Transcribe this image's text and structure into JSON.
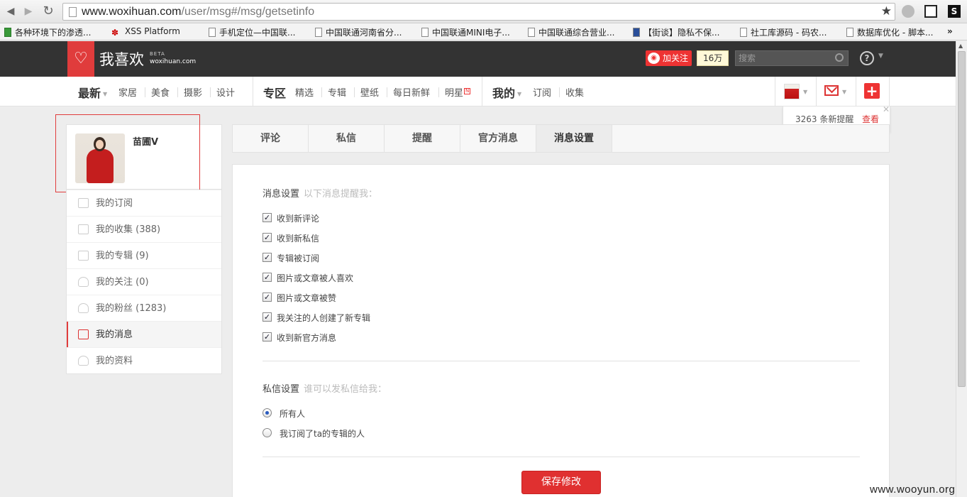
{
  "browser": {
    "url_host": "www.woxihuan.com",
    "url_path": "/user/msg#/msg/getsetinfo",
    "bookmarks": [
      "各种环境下的渗透...",
      "XSS Platform",
      "手机定位—中国联...",
      "中国联通河南省分...",
      "中国联通MINI电子...",
      "中国联通综合营业...",
      "【街谈】隐私不保...",
      "社工库源码 - 码农...",
      "数据库优化 - 脚本..."
    ]
  },
  "header": {
    "logo_text": "我喜欢",
    "logo_beta": "BETA",
    "logo_domain": "woxihuan.com",
    "follow_label": "加关注",
    "fans_count": "16万",
    "search_placeholder": "搜索"
  },
  "nav": {
    "latest": "最新",
    "latest_items": [
      "家居",
      "美食",
      "摄影",
      "设计"
    ],
    "zone": "专区",
    "zone_items": [
      "精选",
      "专辑",
      "壁纸",
      "每日新鲜",
      "明星"
    ],
    "mine": "我的",
    "mine_items": [
      "订阅",
      "收集"
    ]
  },
  "notification": {
    "text": "3263 条新提醒",
    "link": "查看"
  },
  "profile": {
    "username": "苗圃V"
  },
  "side_menu": [
    {
      "label": "我的订阅",
      "active": false
    },
    {
      "label": "我的收集 (388)",
      "active": false
    },
    {
      "label": "我的专辑 (9)",
      "active": false
    },
    {
      "label": "我的关注 (0)",
      "active": false
    },
    {
      "label": "我的粉丝 (1283)",
      "active": false
    },
    {
      "label": "我的消息",
      "active": true
    },
    {
      "label": "我的资料",
      "active": false
    }
  ],
  "tabs": [
    "评论",
    "私信",
    "提醒",
    "官方消息",
    "消息设置"
  ],
  "message_settings": {
    "title": "消息设置",
    "hint": "以下消息提醒我：",
    "options": [
      "收到新评论",
      "收到新私信",
      "专辑被订阅",
      "图片或文章被人喜欢",
      "图片或文章被赞",
      "我关注的人创建了新专辑",
      "收到新官方消息"
    ]
  },
  "private_settings": {
    "title": "私信设置",
    "hint": "谁可以发私信给我：",
    "options": [
      "所有人",
      "我订阅了ta的专辑的人"
    ],
    "selected": "所有人"
  },
  "save_label": "保存修改",
  "watermark": "www.wooyun.org",
  "colors": {
    "accent": "#e03c3c",
    "header_bg": "#333333"
  }
}
